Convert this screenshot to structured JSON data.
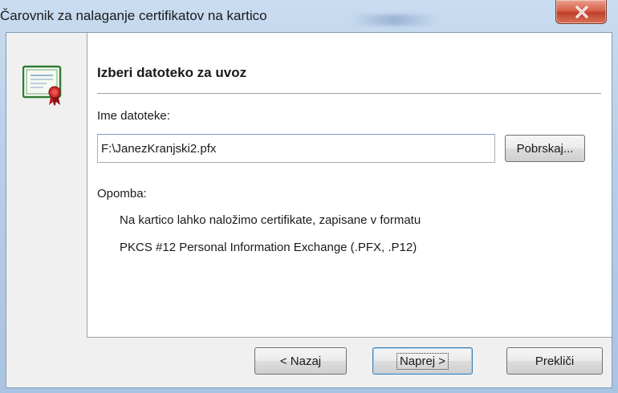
{
  "window": {
    "title": "Čarovnik za nalaganje certifikatov na kartico"
  },
  "page": {
    "heading": "Izberi datoteko za uvoz",
    "file_label": "Ime datoteke:",
    "file_value": "F:\\JanezKranjski2.pfx",
    "browse_label": "Pobrskaj...",
    "note_label": "Opomba:",
    "note_lines": [
      "Na kartico lahko naložimo certifikate, zapisane v formatu",
      "PKCS #12 Personal Information Exchange (.PFX, .P12)"
    ]
  },
  "footer": {
    "back_label": "< Nazaj",
    "next_label": "Naprej >",
    "cancel_label": "Prekliči"
  },
  "icons": {
    "close": "close-icon",
    "certificate": "certificate-icon"
  },
  "colors": {
    "title_bar": "#b8cfe8",
    "close_button": "#c0402a",
    "default_button_border": "#3c7fb1",
    "panel_background": "#f0f0f0"
  }
}
